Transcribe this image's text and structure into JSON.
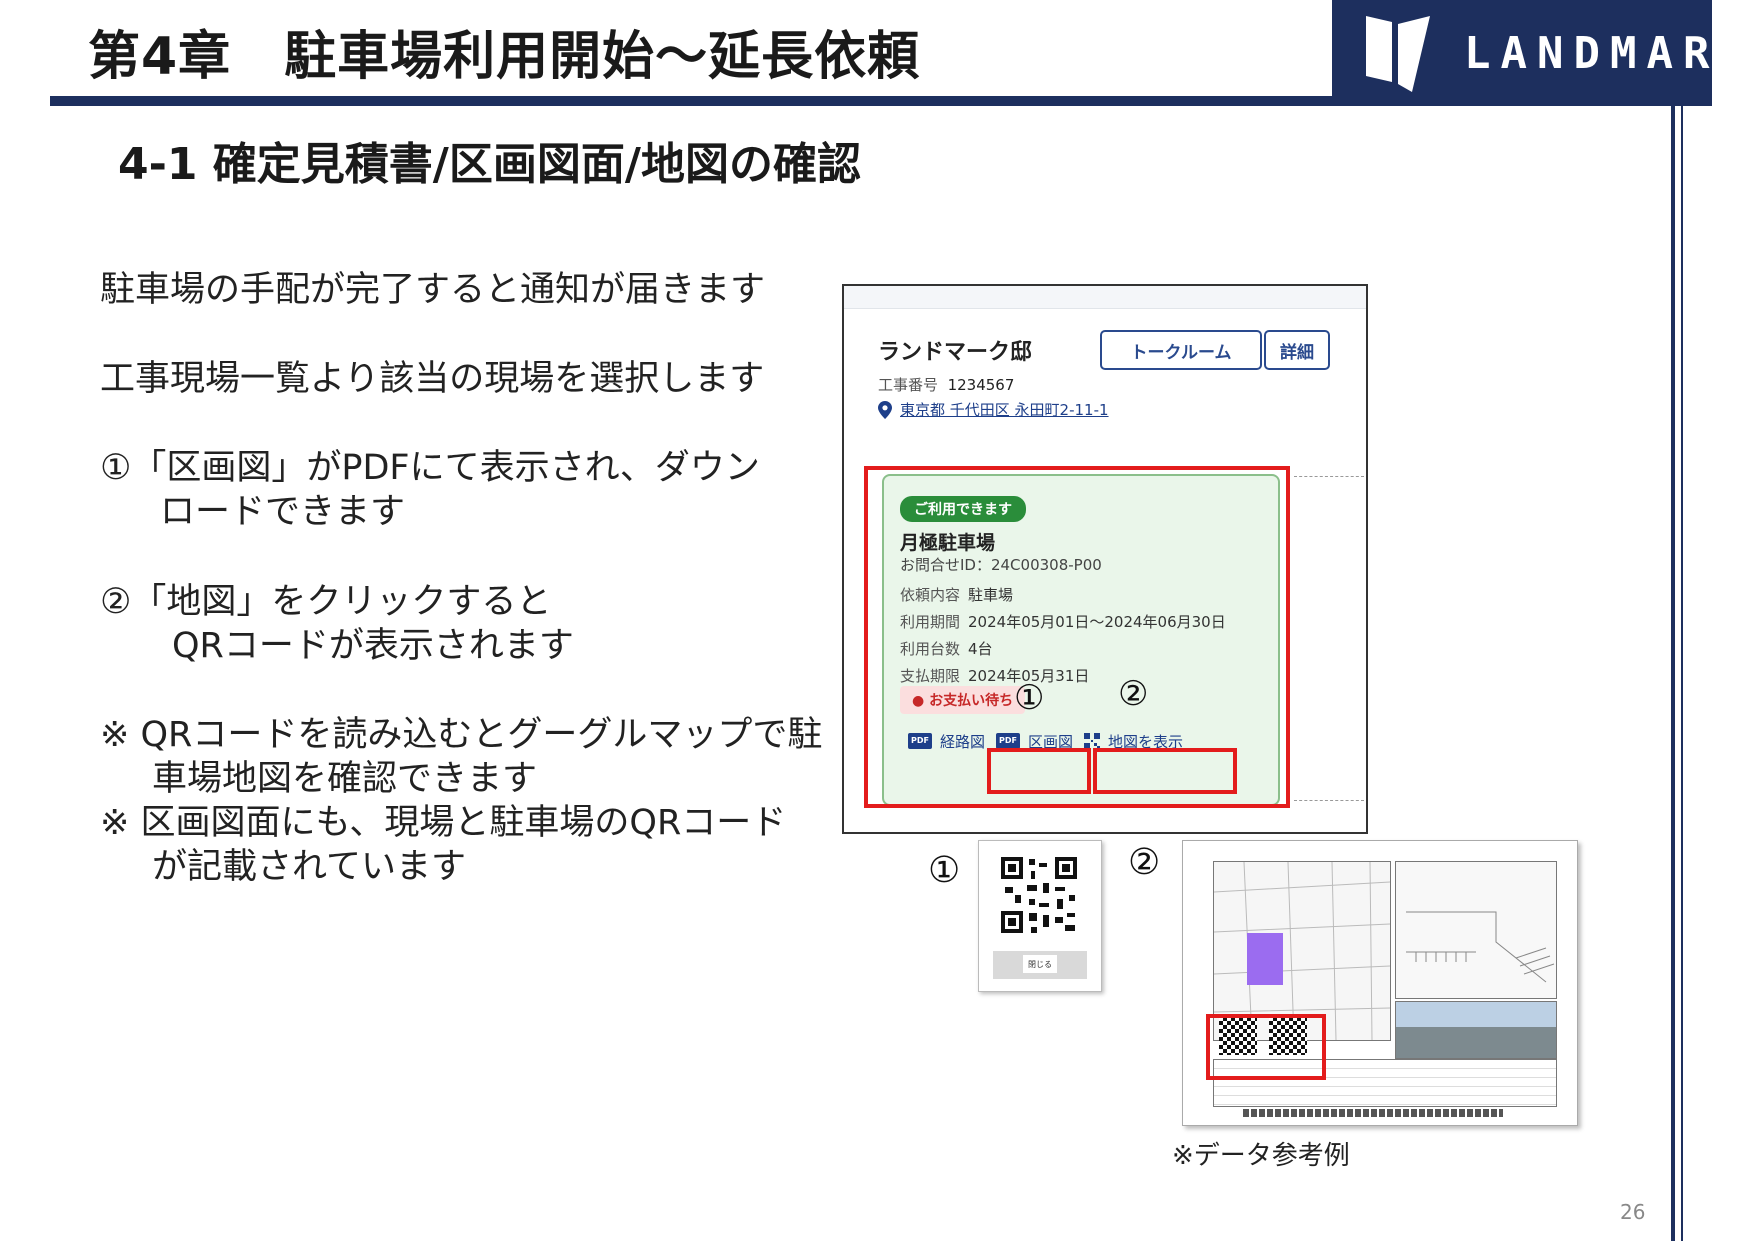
{
  "header": {
    "chapter_title": "第4章　駐車場利用開始～延長依頼",
    "logo_text": "LANDMARK",
    "brand_color": "#1d2f5e"
  },
  "section": {
    "title": "4-1 確定見積書/区画図面/地図の確認"
  },
  "body": {
    "line1": "駐車場の手配が完了すると通知が届きます",
    "line2": "工事現場一覧より該当の現場を選択します",
    "item1_a": "①「区画図」がPDFにて表示され、ダウン",
    "item1_b": "ロードできます",
    "item2_a": "②「地図」をクリックすると",
    "item2_b": "QRコードが表示されます",
    "note1_a": "※ QRコードを読み込むとグーグルマップで駐",
    "note1_b": "車場地図を確認できます",
    "note2_a": "※ 区画図面にも、現場と駐車場のQRコード",
    "note2_b": "が記載されています"
  },
  "app": {
    "site_name": "ランドマーク邸",
    "talk_button": "トークルーム",
    "detail_button": "詳細",
    "job_number_label": "工事番号",
    "job_number": "1234567",
    "address": "東京都 千代田区 永田町2-11-1",
    "parking": {
      "status_badge": "ご利用できます",
      "name": "月極駐車場",
      "inquiry_id": "お問合せID：24C00308-P00",
      "request_label": "依頼内容",
      "request_value": "駐車場",
      "period_label": "利用期間",
      "period_value": "2024年05月01日～2024年06月30日",
      "count_label": "利用台数",
      "count_value": "4台",
      "due_label": "支払期限",
      "due_value": "2024年05月31日",
      "payment_status": "● お支払い待ち",
      "route_button": "経路図",
      "section_button": "区画図",
      "map_button": "地図を表示",
      "pdf_icon_text": "PDF"
    }
  },
  "markers": {
    "one": "①",
    "two": "②"
  },
  "popup": {
    "close_button": "閉じる"
  },
  "reference_note": "※データ参考例",
  "page_number": "26"
}
